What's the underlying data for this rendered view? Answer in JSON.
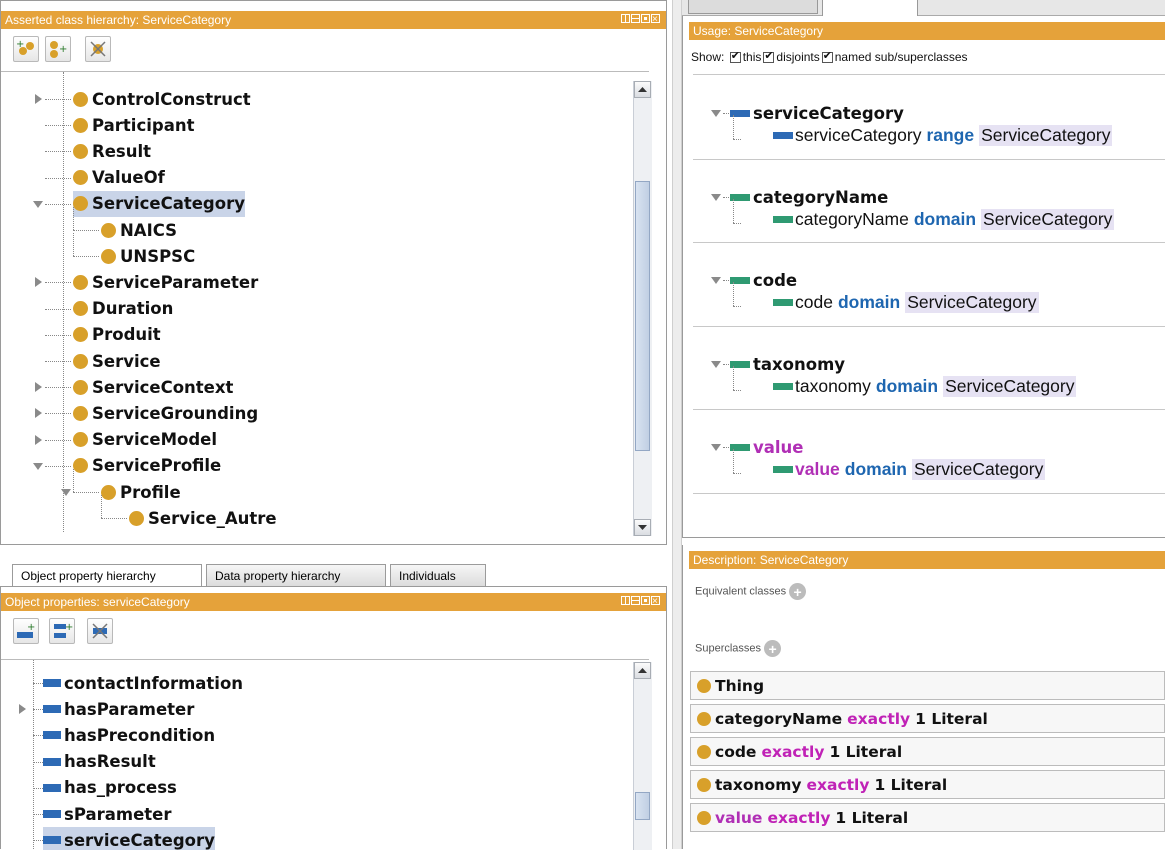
{
  "class_panel": {
    "title": "Asserted class hierarchy: ServiceCategory",
    "tree": [
      {
        "label": "ControlConstruct",
        "indent": 0,
        "expander": "collapsed"
      },
      {
        "label": "Participant",
        "indent": 0,
        "expander": "none"
      },
      {
        "label": "Result",
        "indent": 0,
        "expander": "none"
      },
      {
        "label": "ValueOf",
        "indent": 0,
        "expander": "none"
      },
      {
        "label": "ServiceCategory",
        "indent": 0,
        "expander": "expanded",
        "selected": true
      },
      {
        "label": "NAICS",
        "indent": 1,
        "expander": "none"
      },
      {
        "label": "UNSPSC",
        "indent": 1,
        "expander": "none"
      },
      {
        "label": "ServiceParameter",
        "indent": 0,
        "expander": "collapsed"
      },
      {
        "label": "Duration",
        "indent": 0,
        "expander": "none"
      },
      {
        "label": "Produit",
        "indent": 0,
        "expander": "none"
      },
      {
        "label": "Service",
        "indent": 0,
        "expander": "none"
      },
      {
        "label": "ServiceContext",
        "indent": 0,
        "expander": "collapsed"
      },
      {
        "label": "ServiceGrounding",
        "indent": 0,
        "expander": "collapsed"
      },
      {
        "label": "ServiceModel",
        "indent": 0,
        "expander": "collapsed"
      },
      {
        "label": "ServiceProfile",
        "indent": 0,
        "expander": "expanded"
      },
      {
        "label": "Profile",
        "indent": 1,
        "expander": "expanded"
      },
      {
        "label": "Service_Autre",
        "indent": 2,
        "expander": "none"
      }
    ]
  },
  "tabs": [
    "Object property hierarchy",
    "Data property hierarchy",
    "Individuals"
  ],
  "property_panel": {
    "title": "Object properties: serviceCategory",
    "tree": [
      {
        "label": "contactInformation",
        "expander": "none"
      },
      {
        "label": "hasParameter",
        "expander": "collapsed"
      },
      {
        "label": "hasPrecondition",
        "expander": "none"
      },
      {
        "label": "hasResult",
        "expander": "none"
      },
      {
        "label": "has_process",
        "expander": "none"
      },
      {
        "label": "sParameter",
        "expander": "none"
      },
      {
        "label": "serviceCategory",
        "expander": "none",
        "selected": true
      }
    ]
  },
  "usage_panel": {
    "title": "Usage: ServiceCategory",
    "show_label": "Show:",
    "options": [
      "this",
      "disjoints",
      "named sub/superclasses"
    ],
    "blocks": [
      {
        "name": "serviceCategory",
        "color": "#2d6ab5",
        "name_color": "#111111",
        "keyword": "range",
        "keyword_color": "#1e66b0",
        "target": "ServiceCategory"
      },
      {
        "name": "categoryName",
        "color": "#2f9a72",
        "name_color": "#111111",
        "keyword": "domain",
        "keyword_color": "#1e66b0",
        "target": "ServiceCategory"
      },
      {
        "name": "code",
        "color": "#2f9a72",
        "name_color": "#111111",
        "keyword": "domain",
        "keyword_color": "#1e66b0",
        "target": "ServiceCategory"
      },
      {
        "name": "taxonomy",
        "color": "#2f9a72",
        "name_color": "#111111",
        "keyword": "domain",
        "keyword_color": "#1e66b0",
        "target": "ServiceCategory"
      },
      {
        "name": "value",
        "color": "#2f9a72",
        "name_color": "#b02fb5",
        "keyword": "domain",
        "keyword_color": "#1e66b0",
        "target": "ServiceCategory"
      }
    ]
  },
  "description_panel": {
    "title": "Description: ServiceCategory",
    "equivalent_label": "Equivalent classes",
    "superclasses_label": "Superclasses",
    "superclasses": [
      {
        "prop": "Thing",
        "prop_color": "#111111",
        "restriction": "",
        "rest": ""
      },
      {
        "prop": "categoryName",
        "prop_color": "#111111",
        "restriction": "exactly",
        "rest": "1 Literal"
      },
      {
        "prop": "code",
        "prop_color": "#111111",
        "restriction": "exactly",
        "rest": "1 Literal"
      },
      {
        "prop": "taxonomy",
        "prop_color": "#111111",
        "restriction": "exactly",
        "rest": "1 Literal"
      },
      {
        "prop": "value",
        "prop_color": "#b02fb5",
        "restriction": "exactly",
        "rest": "1 Literal"
      }
    ]
  },
  "colors": {
    "header_orange": "#e5a23a",
    "class_dot": "#d8a02a",
    "object_property": "#2d6ab5",
    "data_property": "#2f9a72",
    "selection": "#c9d4e8",
    "keyword_blue": "#1e66b0",
    "keyword_magenta": "#c022b6"
  },
  "icons": [
    "add-subclass-icon",
    "add-sibling-class-icon",
    "delete-class-icon",
    "add-subproperty-icon",
    "add-sibling-property-icon",
    "delete-property-icon",
    "add-circle-icon"
  ]
}
